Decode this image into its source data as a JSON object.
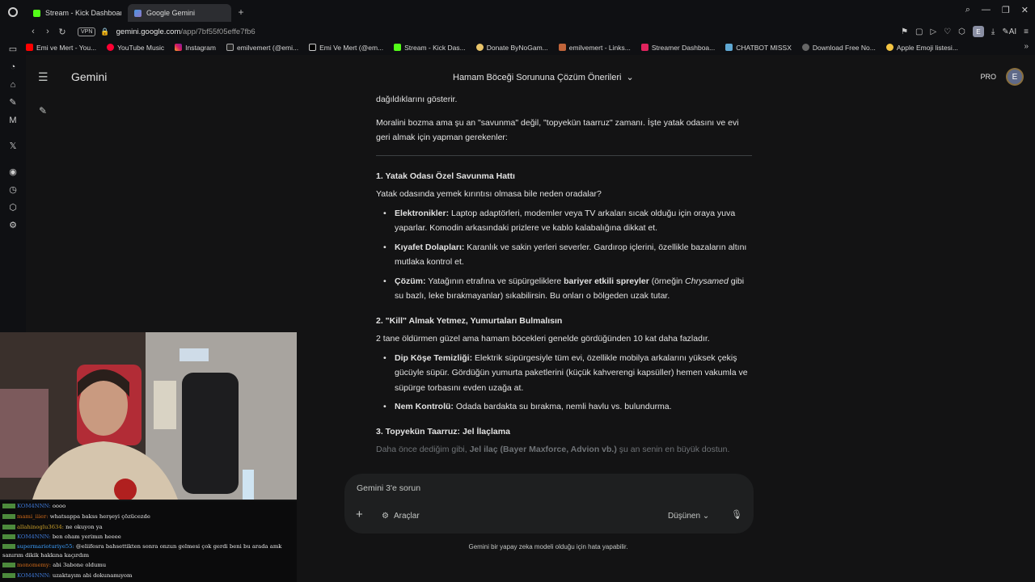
{
  "browser": {
    "tabs": [
      {
        "label": "Stream - Kick Dashboard",
        "active": false,
        "icon": "kick-icon"
      },
      {
        "label": "Google Gemini",
        "active": true,
        "icon": "gemini-icon"
      }
    ],
    "url_host": "gemini.google.com",
    "url_path": "/app/7bf55f05effe7fb6",
    "vpn_label": "VPN",
    "profile_letter": "E",
    "ai_label": "AI",
    "bookmarks": [
      "Emi ve Mert - You...",
      "YouTube Music",
      "Instagram",
      "emilvemert (@emi...",
      "Emi Ve Mert (@em...",
      "Stream - Kick Das...",
      "Donate ByNoGam...",
      "emilvemert - Links...",
      "Streamer Dashboa...",
      "CHATBOT MISSX",
      "Download Free No...",
      "Apple Emoji listesi..."
    ]
  },
  "app": {
    "brand": "Gemini",
    "conversation_title": "Hamam Böceği Sorununa Çözüm Önerileri",
    "pro_label": "PRO",
    "account_letter": "E"
  },
  "response": {
    "intro_tail": "dağıldıklarını gösterir.",
    "intro2": "Moralini bozma ama şu an \"savunma\" değil, \"topyekün taarruz\" zamanı. İşte yatak odasını ve evi geri almak için yapman gerekenler:",
    "s1_title": "1. Yatak Odası Özel Savunma Hattı",
    "s1_lead": "Yatak odasında yemek kırıntısı olmasa bile neden oradalar?",
    "s1_b1_label": "Elektronikler:",
    "s1_b1_text": " Laptop adaptörleri, modemler veya TV arkaları sıcak olduğu için oraya yuva yaparlar. Komodin arkasındaki prizlere ve kablo kalabalığına dikkat et.",
    "s1_b2_label": "Kıyafet Dolapları:",
    "s1_b2_text": " Karanlık ve sakin yerleri severler. Gardırop içlerini, özellikle bazaların altını mutlaka kontrol et.",
    "s1_b3_label": "Çözüm:",
    "s1_b3_text1": " Yatağının etrafına ve süpürgeliklere ",
    "s1_b3_bold": "bariyer etkili spreyler",
    "s1_b3_text2": " (örneğin ",
    "s1_b3_italic": "Chrysamed",
    "s1_b3_text3": " gibi su bazlı, leke bırakmayanlar) sıkabilirsin. Bu onları o bölgeden uzak tutar.",
    "s2_title": "2. \"Kill\" Almak Yetmez, Yumurtaları Bulmalısın",
    "s2_lead": "2 tane öldürmen güzel ama hamam böcekleri genelde gördüğünden 10 kat daha fazladır.",
    "s2_b1_label": "Dip Köşe Temizliği:",
    "s2_b1_text": " Elektrik süpürgesiyle tüm evi, özellikle mobilya arkalarını yüksek çekiş gücüyle süpür. Gördüğün yumurta paketlerini (küçük kahverengi kapsüller) hemen vakumla ve süpürge torbasını evden uzağa at.",
    "s2_b2_label": "Nem Kontrolü:",
    "s2_b2_text": " Odada bardakta su bırakma, nemli havlu vs. bulundurma.",
    "s3_title": "3. Topyekün Taarruz: Jel İlaçlama",
    "s3_lead_a": "Daha önce dediğim gibi, ",
    "s3_lead_bold": "Jel ilaç (Bayer Maxforce, Advion vb.)",
    "s3_lead_b": " şu an senin en büyük dostun."
  },
  "composer": {
    "placeholder": "Gemini 3'e sorun",
    "tools_label": "Araçlar",
    "model_label": "Düşünen"
  },
  "disclaimer": "Gemini bir yapay zeka modeli olduğu için hata yapabilir.",
  "stream_chat": [
    {
      "user": "KOM4NNN:",
      "msg": " oooo",
      "cls": "u"
    },
    {
      "user": "mami_iiier:",
      "msg": " whatsappa bakss herşeyi çözücezde",
      "cls": "u2"
    },
    {
      "user": "allahinoglu3634:",
      "msg": " ne okuyon ya",
      "cls": "u3"
    },
    {
      "user": "KOM4NNN:",
      "msg": " ben oham yerimın heeee",
      "cls": "u"
    },
    {
      "user": "supermarioturiye55:",
      "msg": " @eliifesra bahsettikten sonra onzun gelmesi çok gerdi beni bu arada amk sanırım dikik hakkına kaçırdım",
      "cls": "u4"
    },
    {
      "user": "monomemy:",
      "msg": " abi 3abone oldumu",
      "cls": "u2"
    },
    {
      "user": "KOM4NNN:",
      "msg": " uzaktayım abi dokunamıyom",
      "cls": "u"
    }
  ]
}
